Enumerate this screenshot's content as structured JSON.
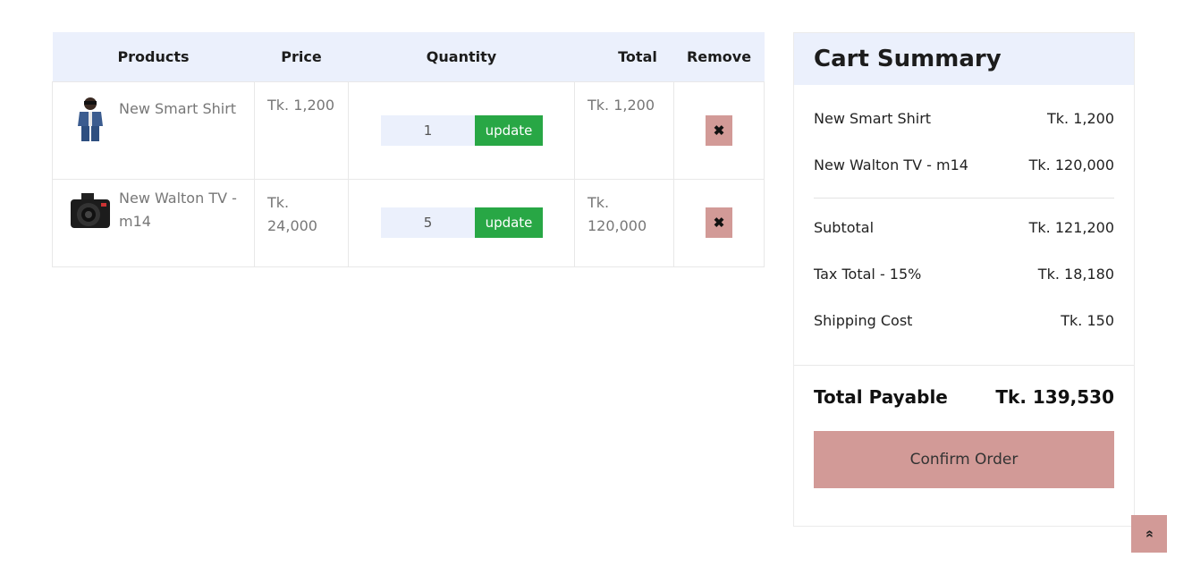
{
  "table": {
    "headers": {
      "products": "Products",
      "price": "Price",
      "quantity": "Quantity",
      "total": "Total",
      "remove": "Remove"
    },
    "rows": [
      {
        "name": "New Smart Shirt",
        "thumb_icon": "shirt-product-thumbnail",
        "price": "Tk. 1,200",
        "quantity": "1",
        "update_label": "update",
        "total": "Tk. 1,200",
        "remove_symbol": "✖"
      },
      {
        "name": "New Walton TV - m14",
        "thumb_icon": "camera-product-thumbnail",
        "price": "Tk. 24,000",
        "quantity": "5",
        "update_label": "update",
        "total": "Tk. 120,000",
        "remove_symbol": "✖"
      }
    ]
  },
  "summary": {
    "title": "Cart Summary",
    "items": [
      {
        "label": "New Smart Shirt",
        "value": "Tk. 1,200"
      },
      {
        "label": "New Walton TV - m14",
        "value": "Tk. 120,000"
      }
    ],
    "subtotal": {
      "label": "Subtotal",
      "value": "Tk. 121,200"
    },
    "tax": {
      "label": "Tax Total - 15%",
      "value": "Tk. 18,180"
    },
    "shipping": {
      "label": "Shipping Cost",
      "value": "Tk. 150"
    },
    "payable": {
      "label": "Total Payable",
      "value": "Tk. 139,530"
    },
    "confirm_label": "Confirm Order"
  },
  "scroll_top_symbol": "»",
  "colors": {
    "header_bg": "#ebf0fc",
    "update_green": "#28a745",
    "accent_rose": "#d29a97"
  }
}
